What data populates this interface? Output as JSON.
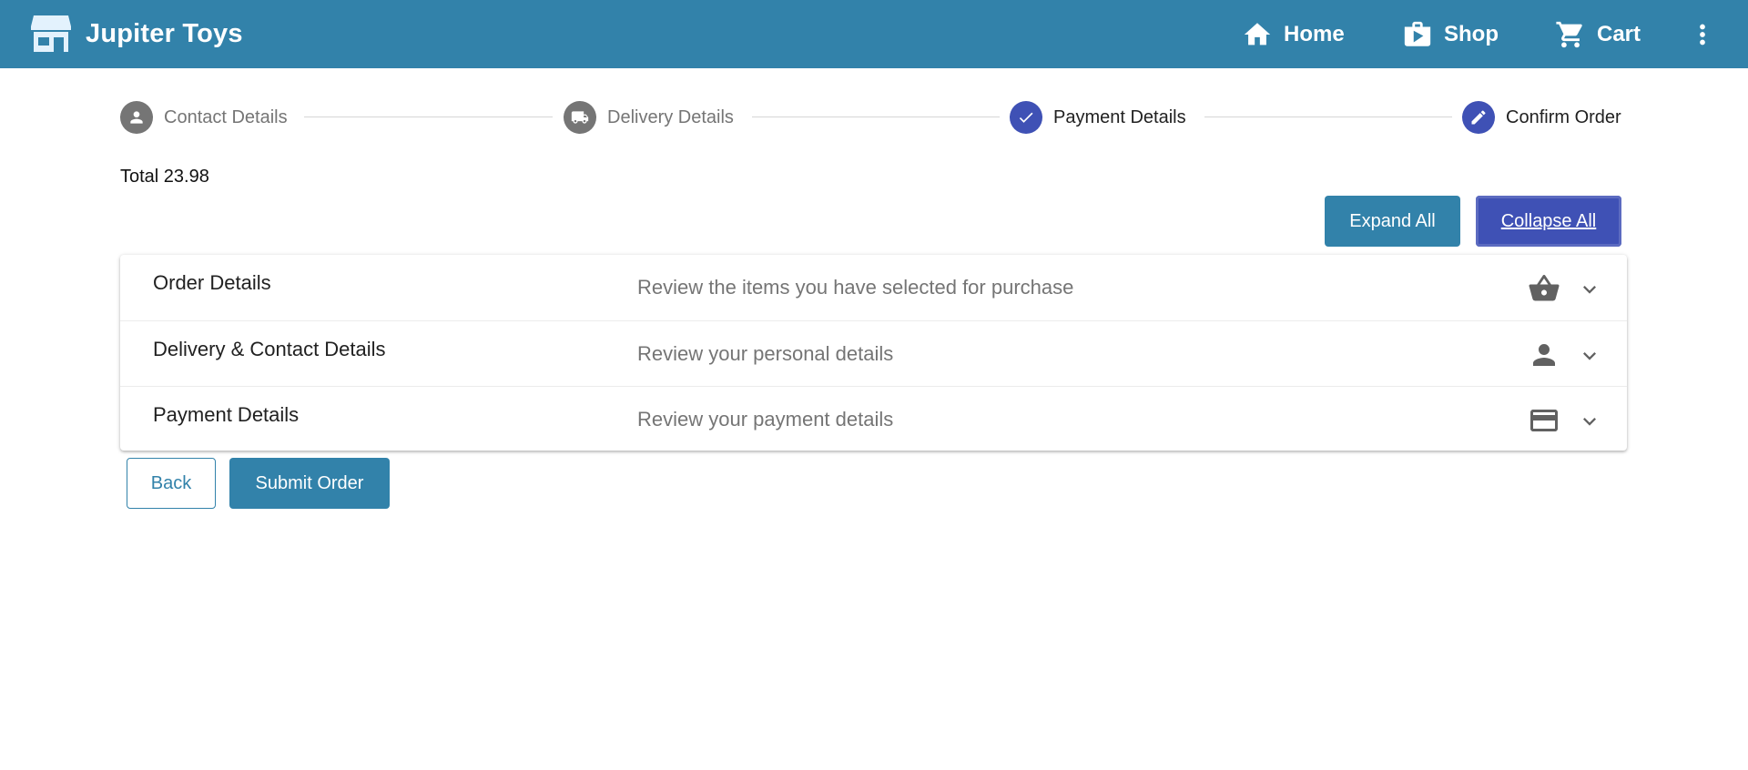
{
  "app": {
    "title": "Jupiter Toys"
  },
  "nav": {
    "home_label": "Home",
    "shop_label": "Shop",
    "cart_label": "Cart"
  },
  "stepper": {
    "steps": [
      {
        "label": "Contact Details",
        "icon": "person-icon",
        "state": "inactive"
      },
      {
        "label": "Delivery Details",
        "icon": "truck-icon",
        "state": "inactive"
      },
      {
        "label": "Payment Details",
        "icon": "check-icon",
        "state": "completed"
      },
      {
        "label": "Confirm Order",
        "icon": "edit-icon",
        "state": "current"
      }
    ]
  },
  "summary": {
    "total_text": "Total 23.98"
  },
  "actions": {
    "expand_all_label": "Expand All",
    "collapse_all_label": "Collapse All",
    "back_label": "Back",
    "submit_label": "Submit Order"
  },
  "panels": [
    {
      "title": "Order Details",
      "description": "Review the items you have selected for purchase",
      "icon": "basket-icon"
    },
    {
      "title": "Delivery & Contact Details",
      "description": "Review your personal details",
      "icon": "person-icon"
    },
    {
      "title": "Payment Details",
      "description": "Review your payment details",
      "icon": "credit-card-icon"
    }
  ],
  "colors": {
    "toolbar": "#3282aa",
    "accent": "#3f51b5",
    "inactive_step": "#757575"
  }
}
